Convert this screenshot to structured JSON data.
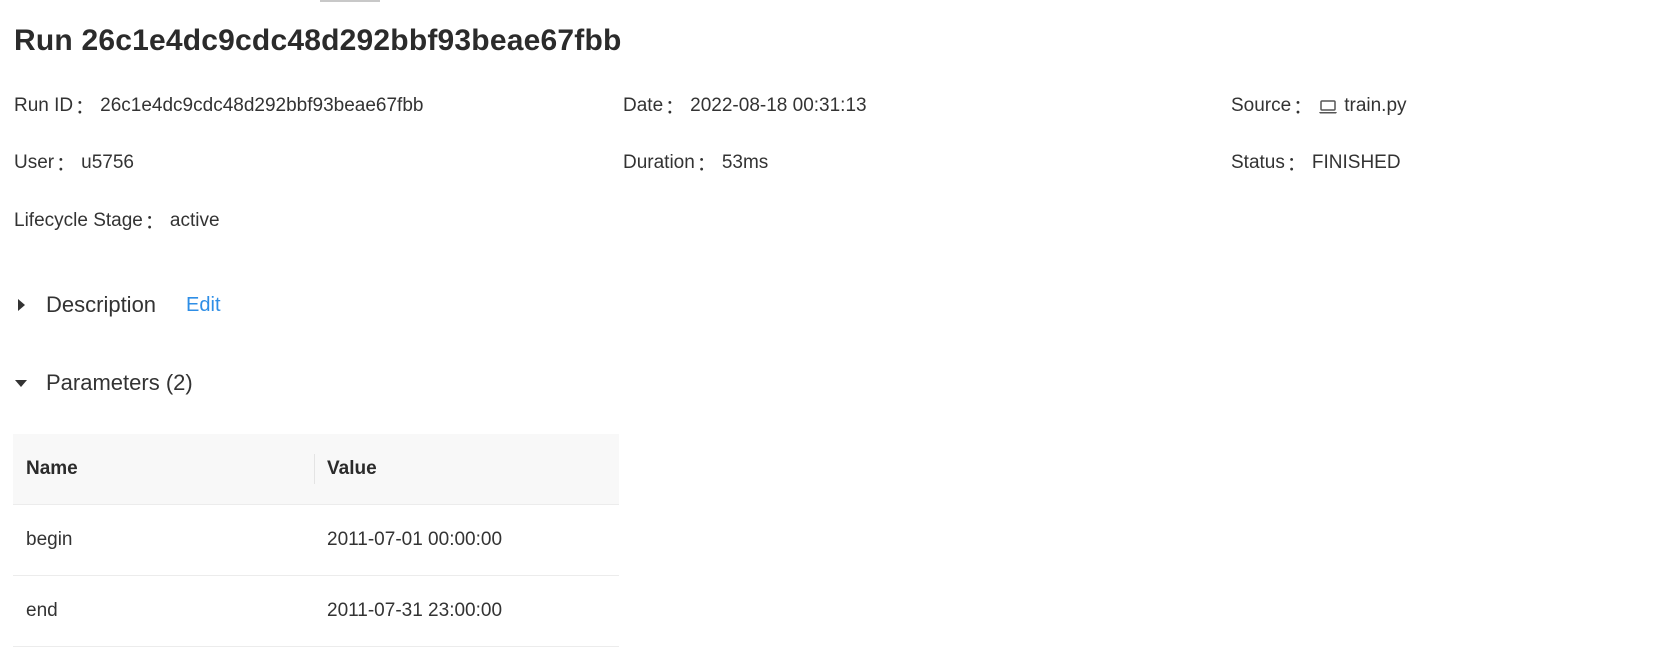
{
  "run": {
    "title": "Run 26c1e4dc9cdc48d292bbf93beae67fbb"
  },
  "metadata": {
    "run_id": {
      "label": "Run ID",
      "value": "26c1e4dc9cdc48d292bbf93beae67fbb"
    },
    "date": {
      "label": "Date",
      "value": "2022-08-18 00:31:13"
    },
    "source": {
      "label": "Source",
      "value": "train.py",
      "icon": "laptop-icon"
    },
    "user": {
      "label": "User",
      "value": "u5756"
    },
    "duration": {
      "label": "Duration",
      "value": "53ms"
    },
    "status": {
      "label": "Status",
      "value": "FINISHED"
    },
    "lifecycle_stage": {
      "label": "Lifecycle Stage",
      "value": "active"
    },
    "separator": "："
  },
  "description": {
    "title": "Description",
    "edit_label": "Edit",
    "expanded": false,
    "icon": "caret-right-icon"
  },
  "parameters": {
    "title": "Parameters (2)",
    "expanded": true,
    "icon": "caret-down-icon",
    "columns": [
      "Name",
      "Value"
    ],
    "rows": [
      {
        "name": "begin",
        "value": "2011-07-01 00:00:00"
      },
      {
        "name": "end",
        "value": "2011-07-31 23:00:00"
      }
    ]
  },
  "colors": {
    "link": "#2e8ee6",
    "table_header_bg": "#f8f8f8",
    "text": "#333333"
  }
}
